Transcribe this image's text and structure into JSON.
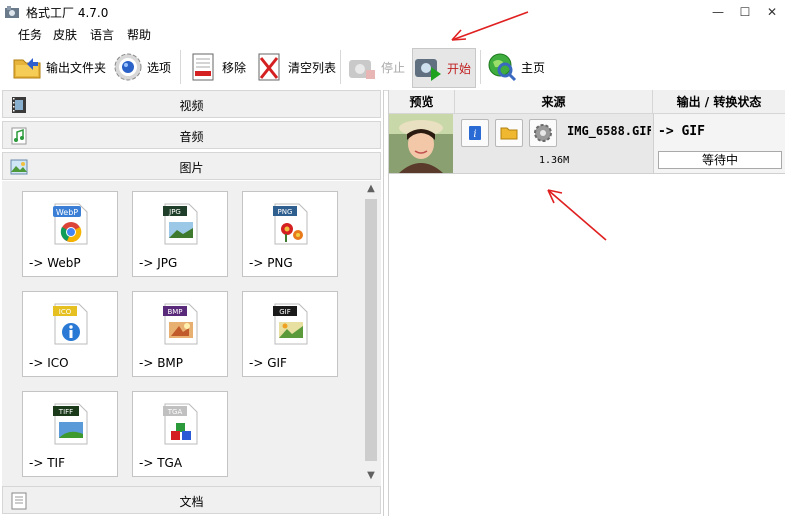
{
  "window": {
    "title": "格式工厂 4.7.0",
    "controls": {
      "minimize": "—",
      "maximize": "☐",
      "close": "✕"
    }
  },
  "menu": {
    "items": [
      "任务",
      "皮肤",
      "语言",
      "帮助"
    ]
  },
  "toolbar": {
    "output_folder": "输出文件夹",
    "options": "选项",
    "remove": "移除",
    "clear_list": "清空列表",
    "stop": "停止",
    "start": "开始",
    "home": "主页"
  },
  "categories": {
    "video": "视频",
    "audio": "音频",
    "image": "图片",
    "document": "文档"
  },
  "formats": [
    {
      "label": "-> WebP",
      "badge": "WebP",
      "color": "#3a7fd5"
    },
    {
      "label": "-> JPG",
      "badge": "JPG",
      "color": "#1f3f2a"
    },
    {
      "label": "-> PNG",
      "badge": "PNG",
      "color": "#2f5f8f"
    },
    {
      "label": "-> ICO",
      "badge": "ICO",
      "color": "#e5c020"
    },
    {
      "label": "-> BMP",
      "badge": "BMP",
      "color": "#5a2a7a"
    },
    {
      "label": "-> GIF",
      "badge": "GIF",
      "color": "#1a1a1a"
    },
    {
      "label": "-> TIF",
      "badge": "TIFF",
      "color": "#1a3a1a"
    },
    {
      "label": "-> TGA",
      "badge": "TGA",
      "color": "#c0c0c0"
    }
  ],
  "table": {
    "headers": {
      "preview": "预览",
      "source": "来源",
      "output_status": "输出 / 转换状态"
    },
    "rows": [
      {
        "filename": "IMG_6588.GIF",
        "size": "1.36M",
        "output_format": "-> GIF",
        "status": "等待中"
      }
    ]
  },
  "colors": {
    "annotation_arrow": "#e02020",
    "header_bg": "#f0f0f0",
    "row_bg": "#e8e8e8"
  }
}
